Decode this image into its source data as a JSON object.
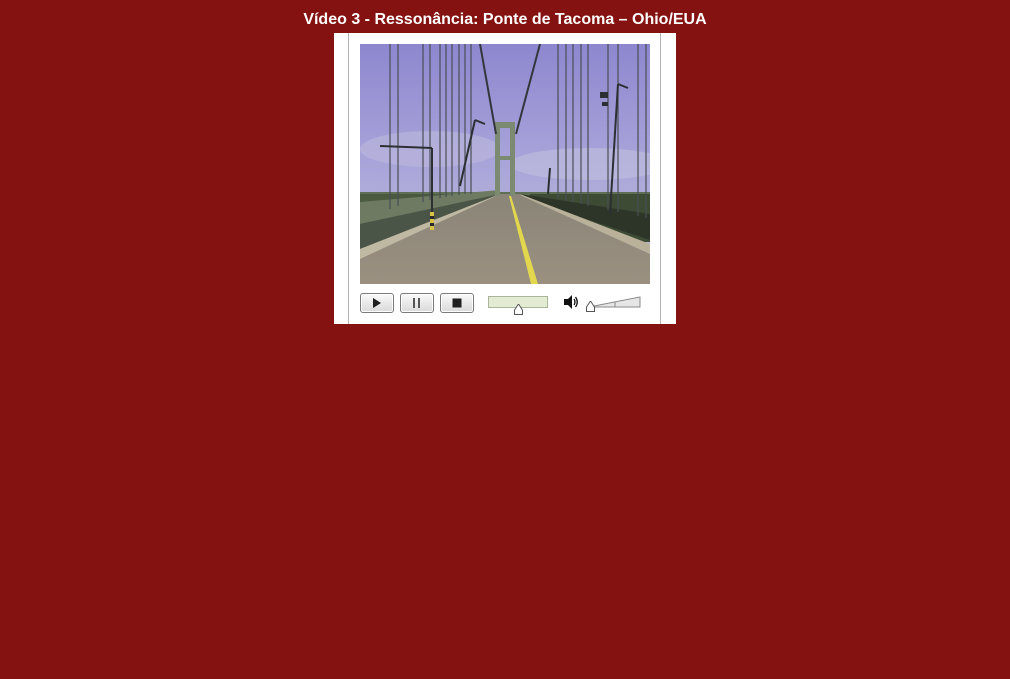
{
  "page": {
    "title": "Vídeo 3 - Ressonância: Ponte de Tacoma – Ohio/EUA"
  },
  "player": {
    "video_description": "Tacoma Narrows bridge roadway with suspension towers and cables",
    "controls": {
      "play": {
        "icon": "play-icon"
      },
      "pause": {
        "icon": "pause-icon"
      },
      "stop": {
        "icon": "stop-icon"
      },
      "seek_position": 0.49,
      "volume_icon": "speaker-icon",
      "volume_level": 0.05
    }
  },
  "colors": {
    "background": "#841210",
    "title_text": "#ffffff",
    "player_frame": "#ffffff",
    "seek_bar": "#e3ecd2"
  }
}
